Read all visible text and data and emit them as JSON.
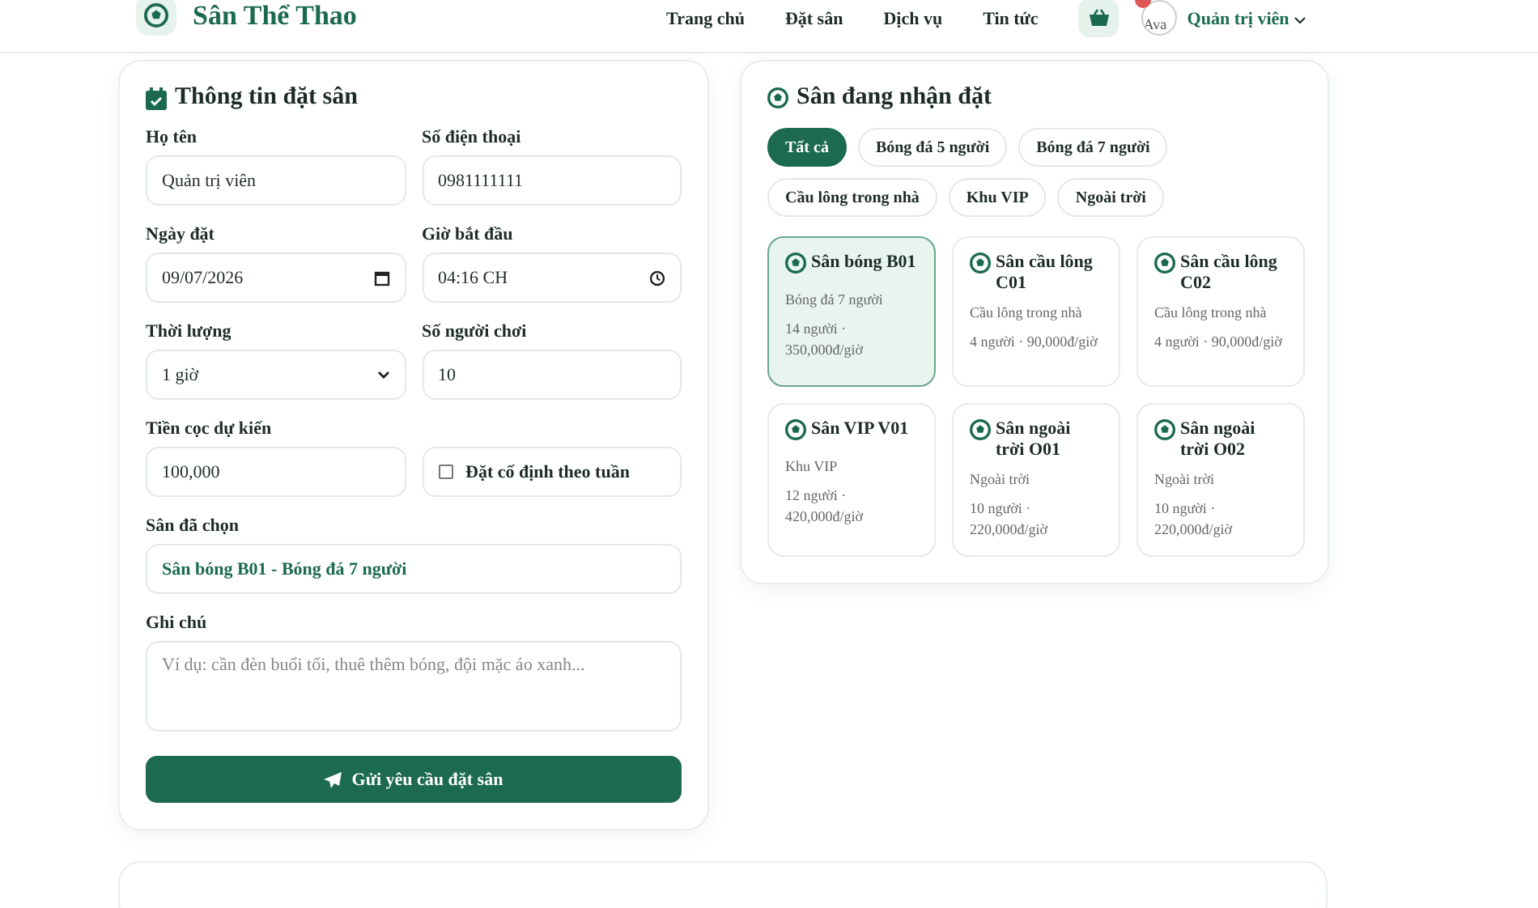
{
  "header": {
    "brand": "Sân Thể Thao",
    "nav": [
      {
        "label": "Trang chủ"
      },
      {
        "label": "Đặt sân"
      },
      {
        "label": "Dịch vụ"
      },
      {
        "label": "Tin tức"
      }
    ],
    "avatar_alt": "Ava",
    "user": "Quản trị viên"
  },
  "booking_form": {
    "title": "Thông tin đặt sân",
    "fields": [
      {
        "kind": "text",
        "label": "Họ tên",
        "value": "Quản trị viên"
      },
      {
        "kind": "text",
        "label": "Số điện thoại",
        "value": "0981111111"
      },
      {
        "kind": "date",
        "label": "Ngày đặt",
        "value": "09/07/2026"
      },
      {
        "kind": "time",
        "label": "Giờ bắt đầu",
        "value": "04:16 CH"
      },
      {
        "kind": "select",
        "label": "Thời lượng",
        "value": "1 giờ"
      },
      {
        "kind": "text",
        "label": "Số người chơi",
        "value": "10"
      },
      {
        "kind": "text",
        "label": "Tiền cọc dự kiến",
        "value": "100,000"
      },
      {
        "kind": "checkbox",
        "label": "Đặt cố định theo tuần",
        "checked": false
      },
      {
        "kind": "readonly",
        "label": "Sân đã chọn",
        "value": "Sân bóng B01 - Bóng đá 7 người"
      },
      {
        "kind": "textarea",
        "label": "Ghi chú",
        "placeholder": "Ví dụ: cần đèn buổi tối, thuê thêm bóng, đội mặc áo xanh..."
      }
    ],
    "submit": "Gửi yêu cầu đặt sân"
  },
  "courts_panel": {
    "title": "Sân đang nhận đặt",
    "filters": [
      {
        "label": "Tất cả",
        "selected": true
      },
      {
        "label": "Bóng đá 5 người",
        "selected": false
      },
      {
        "label": "Bóng đá 7 người",
        "selected": false
      },
      {
        "label": "Cầu lông trong nhà",
        "selected": false
      },
      {
        "label": "Khu VIP",
        "selected": false
      },
      {
        "label": "Ngoài trời",
        "selected": false
      }
    ],
    "courts": [
      {
        "name": "Sân bóng B01",
        "category": "Bóng đá 7 người",
        "info": "14 người · 350,000đ/giờ",
        "selected": true
      },
      {
        "name": "Sân cầu lông C01",
        "category": "Cầu lông trong nhà",
        "info": "4 người · 90,000đ/giờ",
        "selected": false
      },
      {
        "name": "Sân cầu lông C02",
        "category": "Cầu lông trong nhà",
        "info": "4 người · 90,000đ/giờ",
        "selected": false
      },
      {
        "name": "Sân VIP V01",
        "category": "Khu VIP",
        "info": "12 người · 420,000đ/giờ",
        "selected": false
      },
      {
        "name": "Sân ngoài trời O01",
        "category": "Ngoài trời",
        "info": "10 người · 220,000đ/giờ",
        "selected": false
      },
      {
        "name": "Sân ngoài trời O02",
        "category": "Ngoài trời",
        "info": "10 người · 220,000đ/giờ",
        "selected": false
      }
    ]
  }
}
